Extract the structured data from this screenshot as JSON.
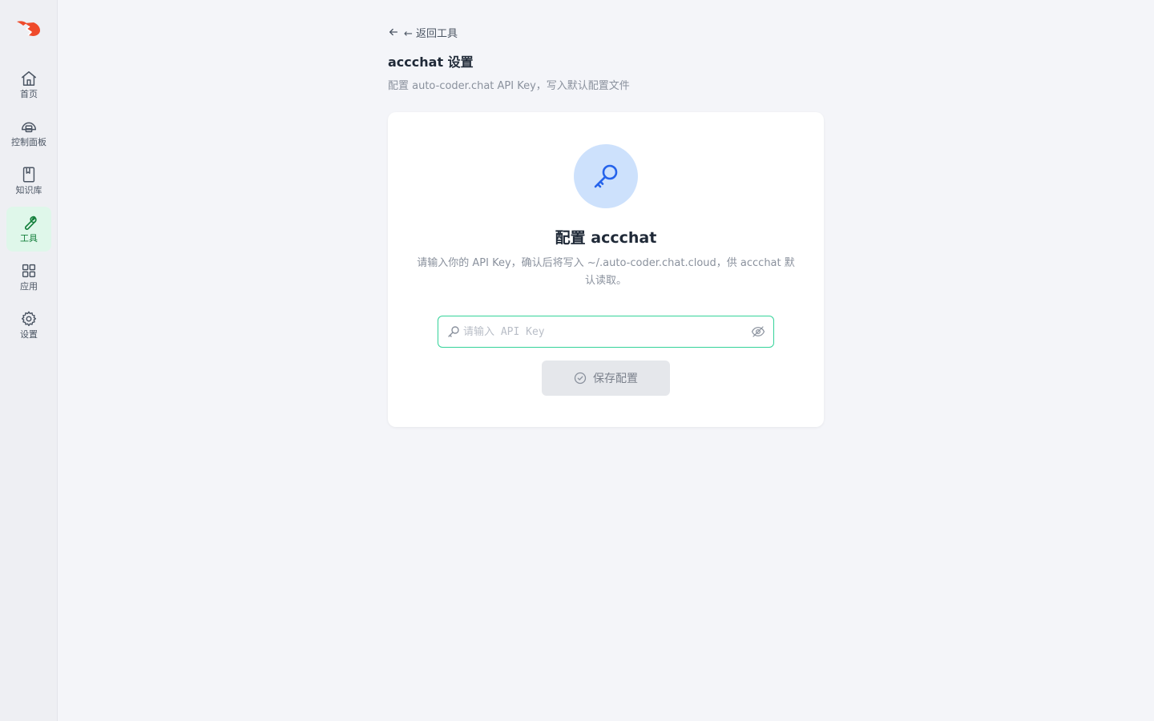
{
  "sidebar": {
    "items": [
      {
        "label": "首页",
        "icon": "home-icon"
      },
      {
        "label": "控制面板",
        "icon": "dashboard-icon"
      },
      {
        "label": "知识库",
        "icon": "book-icon"
      },
      {
        "label": "工具",
        "icon": "wrench-icon",
        "active": true
      },
      {
        "label": "应用",
        "icon": "grid-icon"
      },
      {
        "label": "设置",
        "icon": "gear-icon"
      }
    ]
  },
  "header": {
    "back_label": "← 返回工具",
    "title": "accchat 设置",
    "subtitle": "配置 auto-coder.chat API Key，写入默认配置文件"
  },
  "card": {
    "icon": "key-icon",
    "title": "配置 accchat",
    "description": "请输入你的 API Key，确认后将写入 ~/.auto-coder.chat.cloud，供 accchat 默认读取。",
    "input": {
      "value": "",
      "placeholder": "请输入 API Key"
    },
    "save_label": "保存配置"
  },
  "colors": {
    "accent": "#15803d",
    "active_bg": "#dff7ea",
    "input_border": "#34d399",
    "key_circle": "#cde1fc",
    "key_icon": "#2563eb",
    "logo": "#ef4b2b"
  }
}
